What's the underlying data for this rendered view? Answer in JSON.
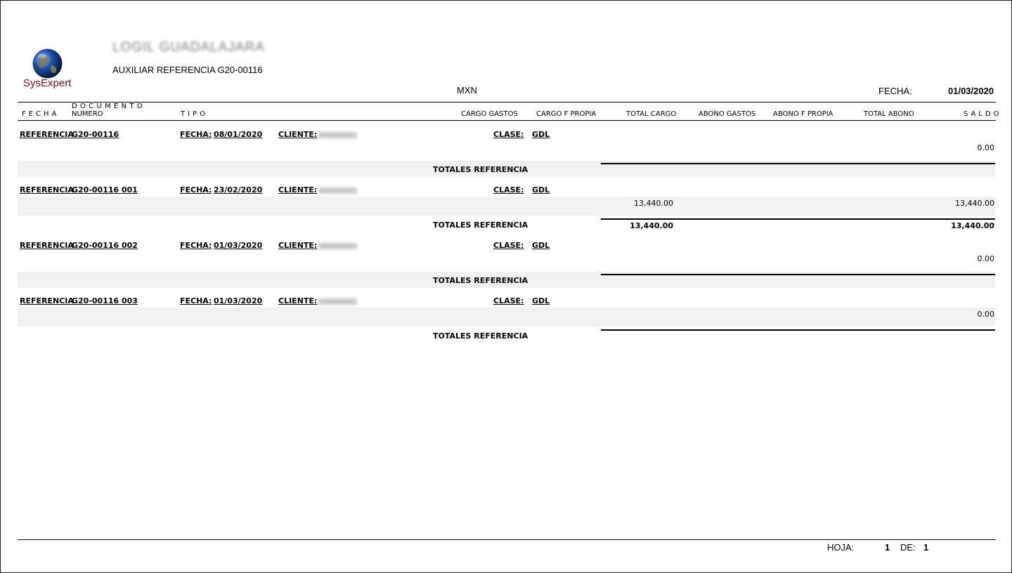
{
  "header": {
    "logo_text": "SysExpert",
    "company_name": "LOGIL GUADALAJARA",
    "report_title": "AUXILIAR REFERENCIA G20-00116",
    "currency": "MXN",
    "date_label": "FECHA:",
    "date_value": "01/03/2020"
  },
  "columns": {
    "fecha": "FECHA",
    "documento": "DOCUMENTO",
    "numero": "NUMERO",
    "tipo": "TIPO",
    "cargo_gastos": "CARGO GASTOS",
    "cargo_f_propia": "CARGO F PROPIA",
    "total_cargo": "TOTAL CARGO",
    "abono_gastos": "ABONO GASTOS",
    "abono_f_propia": "ABONO F PROPIA",
    "total_abono": "TOTAL ABONO",
    "saldo": "SALDO"
  },
  "labels": {
    "referencia": "REFERENCIA",
    "fecha": "FECHA:",
    "cliente": "CLIENTE:",
    "clase": "CLASE:",
    "totales": "TOTALES REFERENCIA"
  },
  "groups": [
    {
      "ref": "G20-00116",
      "fecha": "08/01/2020",
      "clase": "GDL",
      "total_cargo": "",
      "saldo": "0.00",
      "tot_cargo": "",
      "tot_saldo": ""
    },
    {
      "ref": "G20-00116 001",
      "fecha": "23/02/2020",
      "clase": "GDL",
      "total_cargo": "13,440.00",
      "saldo": "13,440.00",
      "tot_cargo": "13,440.00",
      "tot_saldo": "13,440.00"
    },
    {
      "ref": "G20-00116 002",
      "fecha": "01/03/2020",
      "clase": "GDL",
      "total_cargo": "",
      "saldo": "0.00",
      "tot_cargo": "",
      "tot_saldo": ""
    },
    {
      "ref": "G20-00116 003",
      "fecha": "01/03/2020",
      "clase": "GDL",
      "total_cargo": "",
      "saldo": "0.00",
      "tot_cargo": "",
      "tot_saldo": ""
    }
  ],
  "footer": {
    "hoja_label": "HOJA:",
    "hoja_value": "1",
    "de_label": "DE:",
    "de_value": "1"
  }
}
